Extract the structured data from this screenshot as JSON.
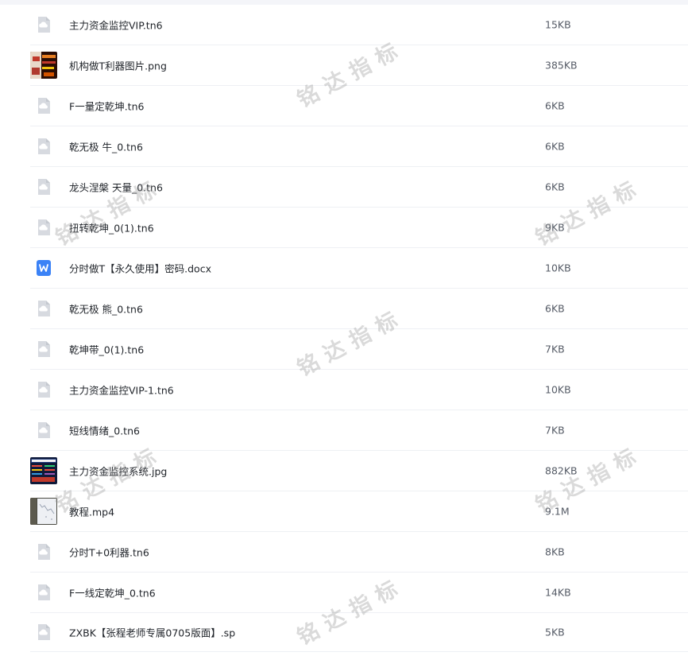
{
  "files": [
    {
      "name": "主力资金监控VIP.tn6",
      "size": "15KB",
      "icon": "file-icon"
    },
    {
      "name": "机构做T利器图片.png",
      "size": "385KB",
      "icon": "image-thumbnail"
    },
    {
      "name": "F一量定乾坤.tn6",
      "size": "6KB",
      "icon": "file-icon"
    },
    {
      "name": "乾无极 牛_0.tn6",
      "size": "6KB",
      "icon": "file-icon"
    },
    {
      "name": "龙头涅槃 天量_0.tn6",
      "size": "6KB",
      "icon": "file-icon"
    },
    {
      "name": "扭转乾坤_0(1).tn6",
      "size": "9KB",
      "icon": "file-icon"
    },
    {
      "name": "分时做T【永久使用】密码.docx",
      "size": "10KB",
      "icon": "word-icon"
    },
    {
      "name": "乾无极 熊_0.tn6",
      "size": "6KB",
      "icon": "file-icon"
    },
    {
      "name": "乾坤带_0(1).tn6",
      "size": "7KB",
      "icon": "file-icon"
    },
    {
      "name": "主力资金监控VIP-1.tn6",
      "size": "10KB",
      "icon": "file-icon"
    },
    {
      "name": "短线情绪_0.tn6",
      "size": "7KB",
      "icon": "file-icon"
    },
    {
      "name": "主力资金监控系统.jpg",
      "size": "882KB",
      "icon": "image-thumbnail"
    },
    {
      "name": "教程.mp4",
      "size": "9.1M",
      "icon": "video-thumbnail"
    },
    {
      "name": "分时T+0利器.tn6",
      "size": "8KB",
      "icon": "file-icon"
    },
    {
      "name": "F一线定乾坤_0.tn6",
      "size": "14KB",
      "icon": "file-icon"
    },
    {
      "name": "ZXBK【张程老师专属0705版面】.sp",
      "size": "5KB",
      "icon": "file-icon"
    }
  ],
  "watermark": {
    "text": "铭达指标",
    "color": "#8c8c8c"
  },
  "colors": {
    "word_icon": "#3b82f6",
    "file_icon": "#d7dae0"
  }
}
